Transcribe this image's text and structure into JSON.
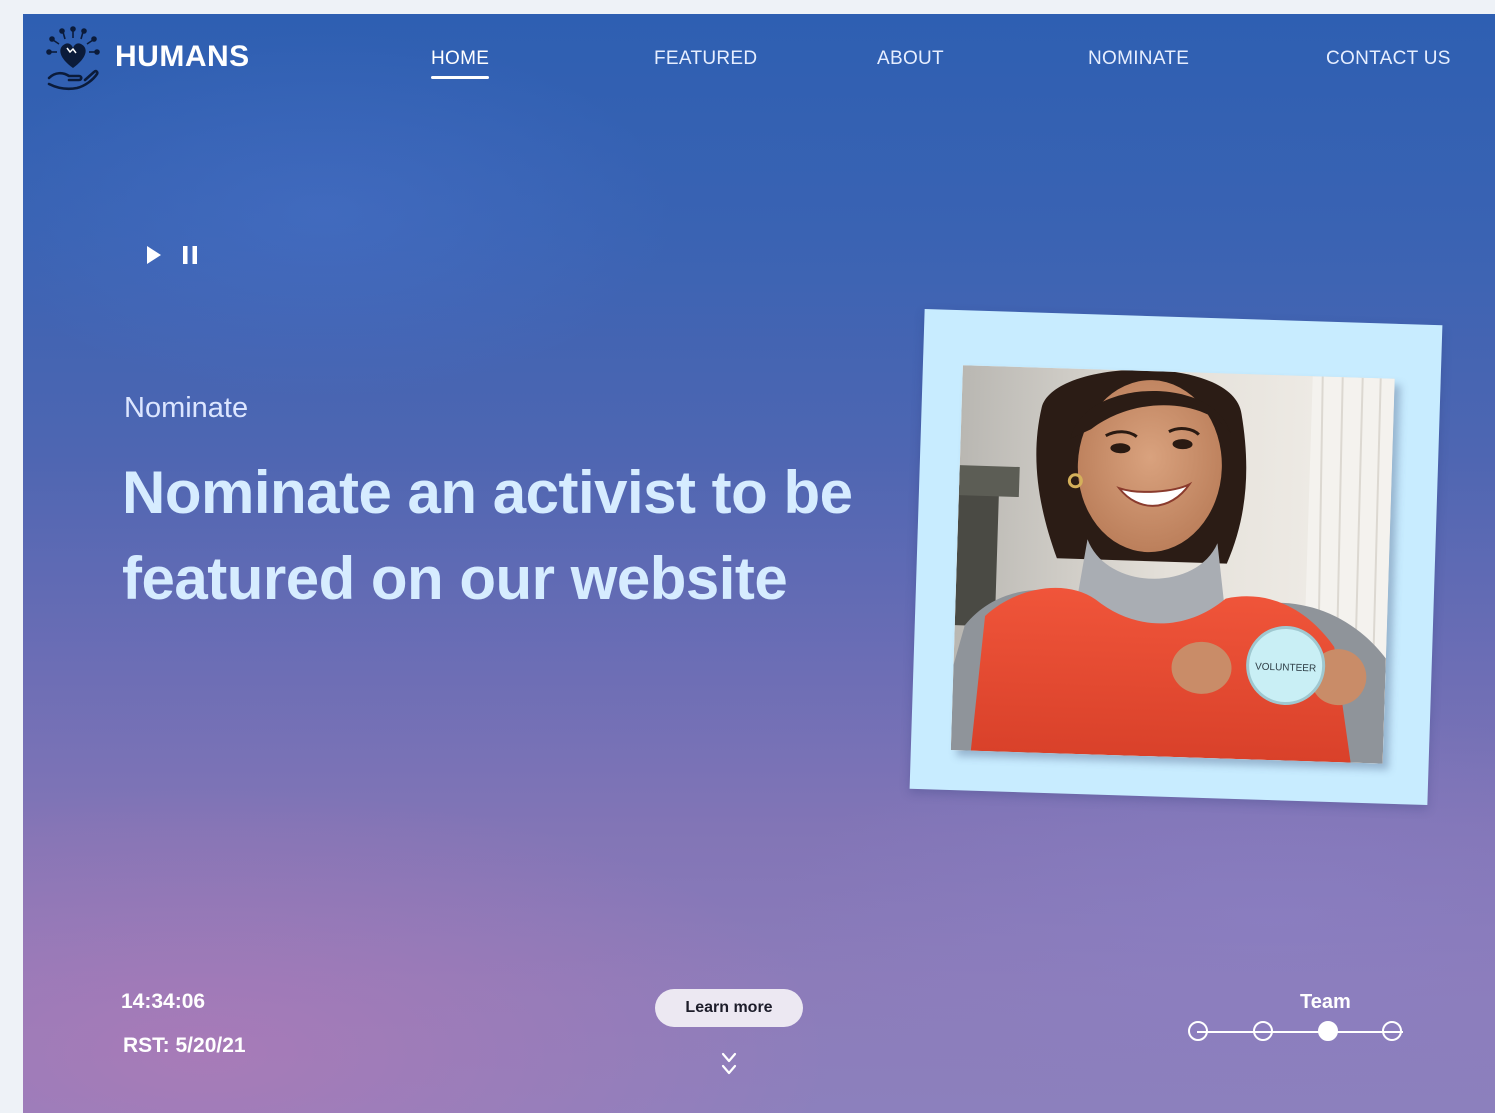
{
  "brand": {
    "name": "HUMANS"
  },
  "nav": {
    "items": [
      {
        "label": "HOME",
        "active": true
      },
      {
        "label": "FEATURED",
        "active": false
      },
      {
        "label": "ABOUT",
        "active": false
      },
      {
        "label": "NOMINATE",
        "active": false
      },
      {
        "label": "CONTACT US",
        "active": false
      }
    ]
  },
  "media": {
    "icons": [
      "play-icon",
      "pause-icon"
    ]
  },
  "hero": {
    "eyebrow": "Nominate",
    "headline": "Nominate an activist to be featured on our website",
    "photo_badge_text": "VOLUNTEER"
  },
  "footer": {
    "clock": "14:34:06",
    "rst": "RST: 5/20/21",
    "learn_more_label": "Learn more",
    "scroll_icon": "chevrons-down-icon",
    "team_label": "Team",
    "steps_total": 4,
    "active_step": 3
  },
  "colors": {
    "headline": "#d6ecff",
    "photo_frame": "#c8ecff",
    "button_bg": "#ece8f2",
    "sky_top": "#2e5fb2",
    "sky_bottom": "#8c80bd"
  }
}
